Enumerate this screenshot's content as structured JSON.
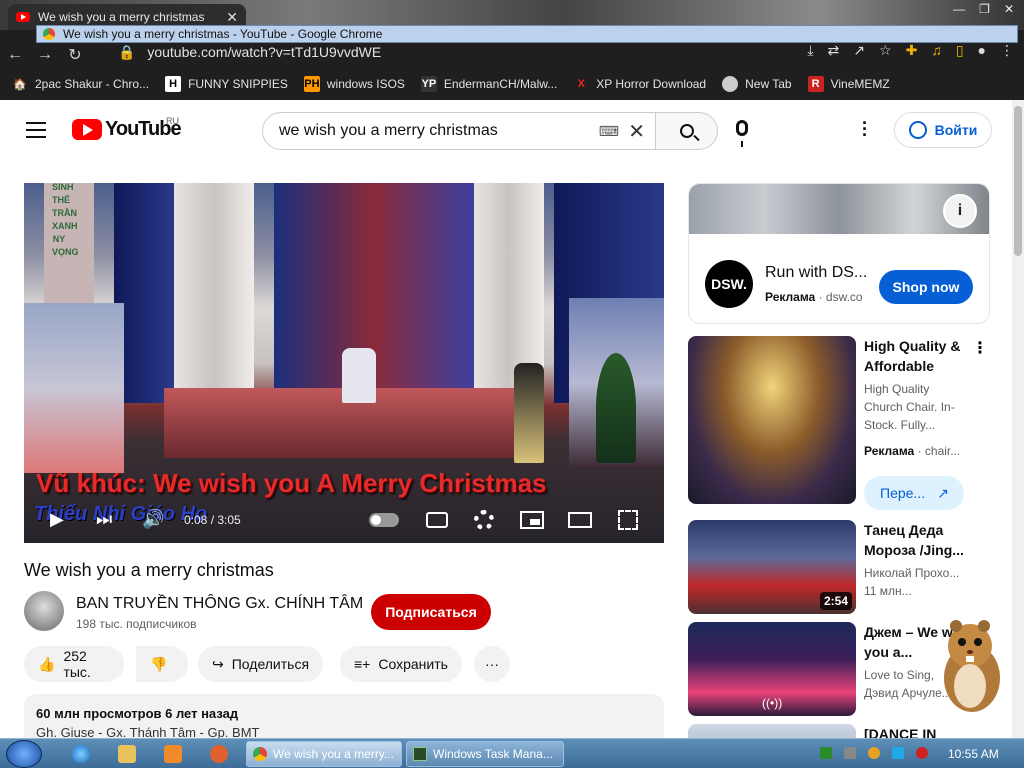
{
  "browser": {
    "tab_title": "We wish you a merry christmas",
    "tooltip": "We wish you a merry christmas - YouTube - Google Chrome",
    "url": "youtube.com/watch?v=tTd1U9vvdWE",
    "bookmarks": [
      {
        "label": "2pac Shakur - Chro...",
        "icon": "globe-icon"
      },
      {
        "label": "FUNNY SNIPPIES",
        "icon": "H"
      },
      {
        "label": "windows ISOS",
        "icon": "PH"
      },
      {
        "label": "EndermanCH/Malw...",
        "icon": "YP"
      },
      {
        "label": "XP Horror Download",
        "icon": "X"
      },
      {
        "label": "New Tab",
        "icon": "globe-icon"
      },
      {
        "label": "VineMEMZ",
        "icon": "R"
      }
    ]
  },
  "youtube": {
    "logo_text": "YouTube",
    "region": "RU",
    "search_value": "we wish you a merry christmas",
    "signin_label": "Войти"
  },
  "video": {
    "subtitle_line1": "Vũ khúc: We wish you A Merry Christmas",
    "subtitle_line2": "Thiếu Nhi Giáo Họ",
    "side_text": "SINH THỂ TRẦN XANH NY VỌNG",
    "time_current": "0:08",
    "time_total": "3:05",
    "title": "We wish you a merry christmas"
  },
  "channel": {
    "name": "BAN TRUYỀN THÔNG Gx. CHÍNH TÂM",
    "subscribers": "198 тыс. подписчиков",
    "subscribe_label": "Подписаться"
  },
  "actions": {
    "likes": "252 тыс.",
    "share": "Поделиться",
    "save": "Сохранить"
  },
  "description": {
    "stats": "60 млн просмотров  6 лет назад",
    "line2": "Gh. Giuse - Gx. Thánh Tâm - Gp. BMT"
  },
  "sidebar": {
    "ad": {
      "logo": "DSW.",
      "title": "Run with DS...",
      "label": "Реклама",
      "domain": "dsw.co",
      "cta": "Shop now"
    },
    "videos": [
      {
        "title": "High Quality & Affordable",
        "meta": "High Quality Church Chair. In-Stock. Fully...",
        "label": "Реклама",
        "domain": "chair...",
        "cta": "Пере..."
      },
      {
        "title": "Танец Деда Мороза /Jing...",
        "meta": "Николай Прохо...",
        "meta2": "11 млн...",
        "duration": "2:54"
      },
      {
        "title": "Джем – We wish you a...",
        "meta": "Love to Sing, Дэвид Арчуле..."
      },
      {
        "title": "[DANCE IN"
      }
    ]
  },
  "taskbar": {
    "tasks": [
      {
        "label": "We wish you a merry..."
      },
      {
        "label": "Windows Task Mana..."
      }
    ],
    "clock": "10:55 AM"
  },
  "colors": {
    "yt_red": "#ff0000",
    "subscribe_red": "#cc0000",
    "link_blue": "#065fd4",
    "chrome_dark": "#1f1f1f"
  }
}
